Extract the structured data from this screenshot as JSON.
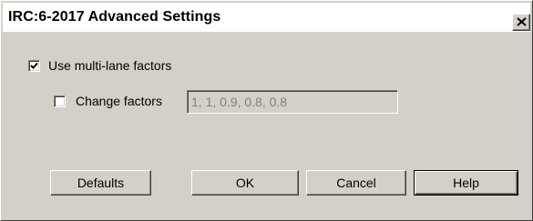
{
  "window": {
    "title": "IRC:6-2017 Advanced Settings",
    "close_symbol": "×"
  },
  "options": {
    "multi_lane": {
      "label": "Use multi-lane factors",
      "checked": true
    },
    "change_factors": {
      "label": "Change factors",
      "checked": false
    },
    "factors_value": "1, 1, 0.9, 0.8, 0.8"
  },
  "buttons": {
    "defaults": "Defaults",
    "ok": "OK",
    "cancel": "Cancel",
    "help": "Help"
  },
  "icons": {
    "close": "close-icon",
    "check": "checkmark-icon"
  }
}
